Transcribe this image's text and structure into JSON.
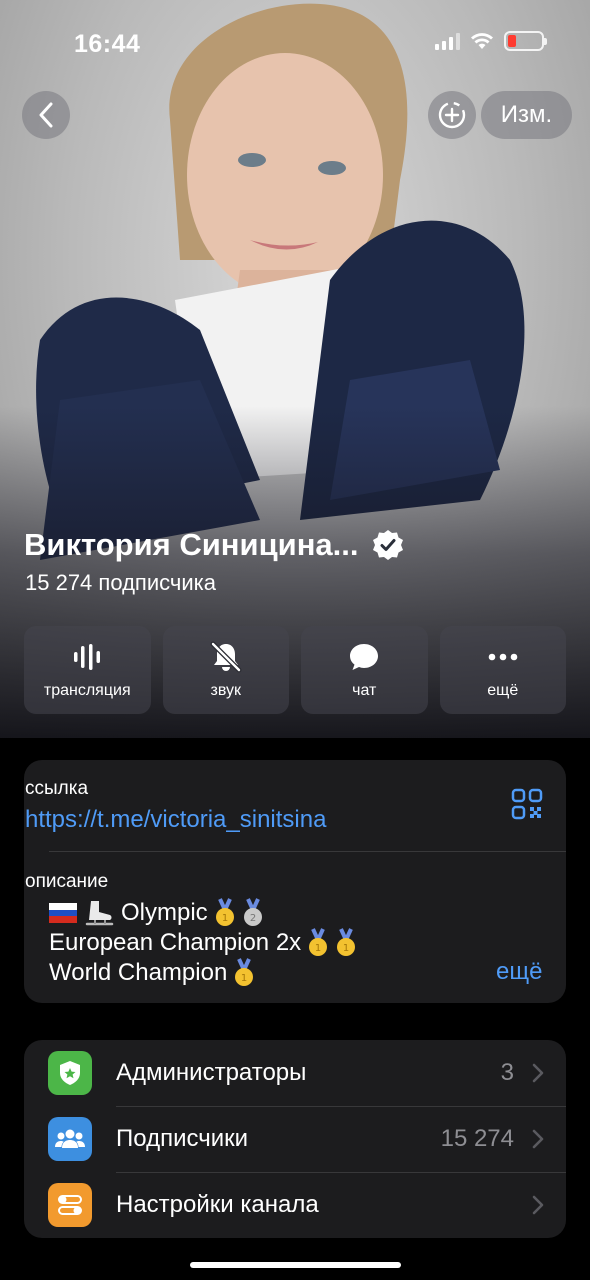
{
  "status_bar": {
    "time": "16:44"
  },
  "nav": {
    "edit_label": "Изм."
  },
  "channel": {
    "name": "Виктория Синицина...",
    "subscribers": "15 274 подписчика"
  },
  "actions": [
    {
      "label": "трансляция",
      "icon": "broadcast-icon"
    },
    {
      "label": "звук",
      "icon": "bell-slash-icon"
    },
    {
      "label": "чат",
      "icon": "chat-bubble-icon"
    },
    {
      "label": "ещё",
      "icon": "more-dots-icon"
    }
  ],
  "info": {
    "link_label": "ссылка",
    "link_value": "https://t.me/victoria_sinitsina",
    "description_label": "описание",
    "description_lines": [
      "Olympic",
      "European Champion 2x",
      "World Champion"
    ],
    "more_label": "ещё"
  },
  "settings": [
    {
      "label": "Администраторы",
      "value": "3",
      "icon": "shield-star-icon",
      "color": "#4cb648"
    },
    {
      "label": "Подписчики",
      "value": "15 274",
      "icon": "people-icon",
      "color": "#3d8fe0"
    },
    {
      "label": "Настройки канала",
      "value": "",
      "icon": "toggles-icon",
      "color": "#f29a2e"
    }
  ],
  "colors": {
    "link": "#4f9bf7",
    "card_bg": "#1c1c1e",
    "battery_low": "#ff3b30"
  }
}
